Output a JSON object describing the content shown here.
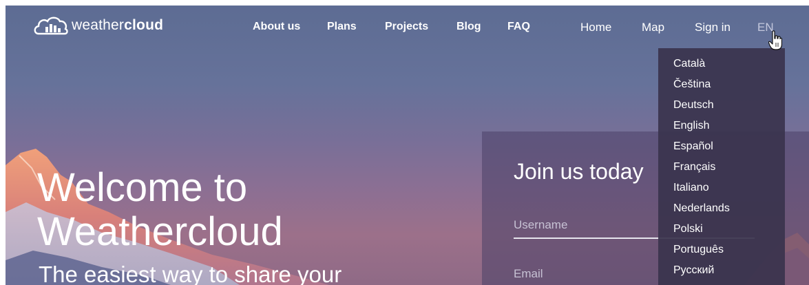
{
  "brand": {
    "name_light": "weather",
    "name_bold": "cloud"
  },
  "nav": {
    "primary": [
      "About us",
      "Plans",
      "Projects",
      "Blog",
      "FAQ"
    ],
    "secondary": [
      "Home",
      "Map",
      "Sign in"
    ],
    "language": "EN"
  },
  "language_menu": [
    "Català",
    "Čeština",
    "Deutsch",
    "English",
    "Español",
    "Français",
    "Italiano",
    "Nederlands",
    "Polski",
    "Português",
    "Русский"
  ],
  "hero": {
    "title_line1": "Welcome to",
    "title_line2": "Weathercloud",
    "subtitle": "The easiest way to share your"
  },
  "join": {
    "title": "Join us today",
    "username_placeholder": "Username",
    "email_placeholder": "Email"
  },
  "icons": [
    "cloud-bars-logo-icon",
    "hand-pointer-icon"
  ],
  "colors": {
    "sky_top": "#5d6c93",
    "sky_bottom": "#9c708a",
    "panel": "#4e4469",
    "menu": "#3a344e",
    "text": "#ffffff"
  }
}
